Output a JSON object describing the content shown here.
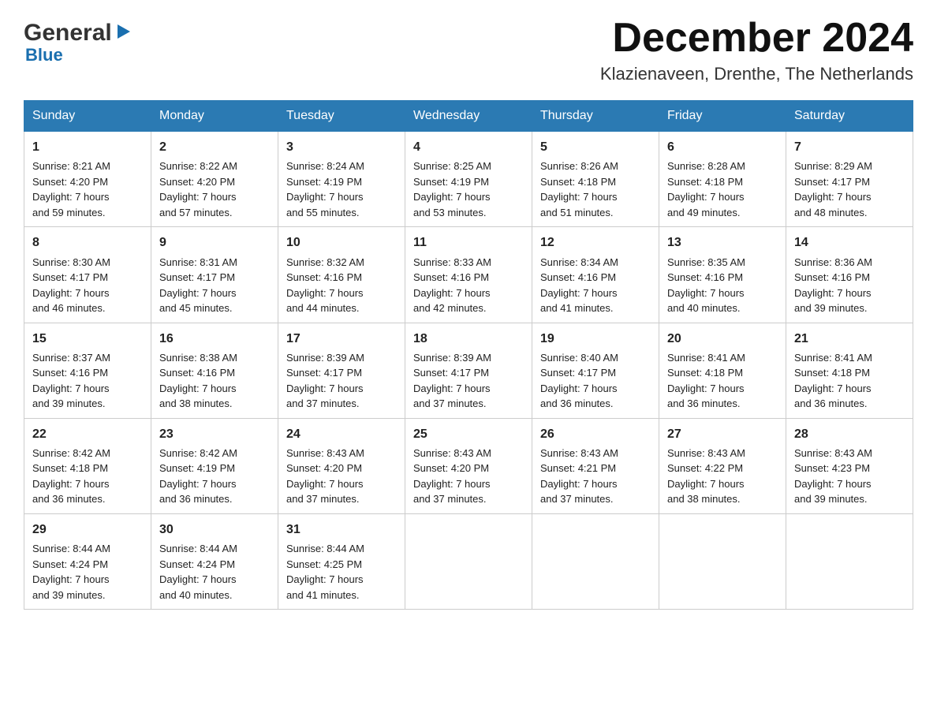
{
  "header": {
    "month_title": "December 2024",
    "location": "Klazienaveen, Drenthe, The Netherlands",
    "logo_general": "General",
    "logo_blue": "Blue"
  },
  "days_of_week": [
    "Sunday",
    "Monday",
    "Tuesday",
    "Wednesday",
    "Thursday",
    "Friday",
    "Saturday"
  ],
  "weeks": [
    [
      {
        "day": "1",
        "sunrise": "8:21 AM",
        "sunset": "4:20 PM",
        "daylight": "7 hours and 59 minutes."
      },
      {
        "day": "2",
        "sunrise": "8:22 AM",
        "sunset": "4:20 PM",
        "daylight": "7 hours and 57 minutes."
      },
      {
        "day": "3",
        "sunrise": "8:24 AM",
        "sunset": "4:19 PM",
        "daylight": "7 hours and 55 minutes."
      },
      {
        "day": "4",
        "sunrise": "8:25 AM",
        "sunset": "4:19 PM",
        "daylight": "7 hours and 53 minutes."
      },
      {
        "day": "5",
        "sunrise": "8:26 AM",
        "sunset": "4:18 PM",
        "daylight": "7 hours and 51 minutes."
      },
      {
        "day": "6",
        "sunrise": "8:28 AM",
        "sunset": "4:18 PM",
        "daylight": "7 hours and 49 minutes."
      },
      {
        "day": "7",
        "sunrise": "8:29 AM",
        "sunset": "4:17 PM",
        "daylight": "7 hours and 48 minutes."
      }
    ],
    [
      {
        "day": "8",
        "sunrise": "8:30 AM",
        "sunset": "4:17 PM",
        "daylight": "7 hours and 46 minutes."
      },
      {
        "day": "9",
        "sunrise": "8:31 AM",
        "sunset": "4:17 PM",
        "daylight": "7 hours and 45 minutes."
      },
      {
        "day": "10",
        "sunrise": "8:32 AM",
        "sunset": "4:16 PM",
        "daylight": "7 hours and 44 minutes."
      },
      {
        "day": "11",
        "sunrise": "8:33 AM",
        "sunset": "4:16 PM",
        "daylight": "7 hours and 42 minutes."
      },
      {
        "day": "12",
        "sunrise": "8:34 AM",
        "sunset": "4:16 PM",
        "daylight": "7 hours and 41 minutes."
      },
      {
        "day": "13",
        "sunrise": "8:35 AM",
        "sunset": "4:16 PM",
        "daylight": "7 hours and 40 minutes."
      },
      {
        "day": "14",
        "sunrise": "8:36 AM",
        "sunset": "4:16 PM",
        "daylight": "7 hours and 39 minutes."
      }
    ],
    [
      {
        "day": "15",
        "sunrise": "8:37 AM",
        "sunset": "4:16 PM",
        "daylight": "7 hours and 39 minutes."
      },
      {
        "day": "16",
        "sunrise": "8:38 AM",
        "sunset": "4:16 PM",
        "daylight": "7 hours and 38 minutes."
      },
      {
        "day": "17",
        "sunrise": "8:39 AM",
        "sunset": "4:17 PM",
        "daylight": "7 hours and 37 minutes."
      },
      {
        "day": "18",
        "sunrise": "8:39 AM",
        "sunset": "4:17 PM",
        "daylight": "7 hours and 37 minutes."
      },
      {
        "day": "19",
        "sunrise": "8:40 AM",
        "sunset": "4:17 PM",
        "daylight": "7 hours and 36 minutes."
      },
      {
        "day": "20",
        "sunrise": "8:41 AM",
        "sunset": "4:18 PM",
        "daylight": "7 hours and 36 minutes."
      },
      {
        "day": "21",
        "sunrise": "8:41 AM",
        "sunset": "4:18 PM",
        "daylight": "7 hours and 36 minutes."
      }
    ],
    [
      {
        "day": "22",
        "sunrise": "8:42 AM",
        "sunset": "4:18 PM",
        "daylight": "7 hours and 36 minutes."
      },
      {
        "day": "23",
        "sunrise": "8:42 AM",
        "sunset": "4:19 PM",
        "daylight": "7 hours and 36 minutes."
      },
      {
        "day": "24",
        "sunrise": "8:43 AM",
        "sunset": "4:20 PM",
        "daylight": "7 hours and 37 minutes."
      },
      {
        "day": "25",
        "sunrise": "8:43 AM",
        "sunset": "4:20 PM",
        "daylight": "7 hours and 37 minutes."
      },
      {
        "day": "26",
        "sunrise": "8:43 AM",
        "sunset": "4:21 PM",
        "daylight": "7 hours and 37 minutes."
      },
      {
        "day": "27",
        "sunrise": "8:43 AM",
        "sunset": "4:22 PM",
        "daylight": "7 hours and 38 minutes."
      },
      {
        "day": "28",
        "sunrise": "8:43 AM",
        "sunset": "4:23 PM",
        "daylight": "7 hours and 39 minutes."
      }
    ],
    [
      {
        "day": "29",
        "sunrise": "8:44 AM",
        "sunset": "4:24 PM",
        "daylight": "7 hours and 39 minutes."
      },
      {
        "day": "30",
        "sunrise": "8:44 AM",
        "sunset": "4:24 PM",
        "daylight": "7 hours and 40 minutes."
      },
      {
        "day": "31",
        "sunrise": "8:44 AM",
        "sunset": "4:25 PM",
        "daylight": "7 hours and 41 minutes."
      },
      null,
      null,
      null,
      null
    ]
  ],
  "labels": {
    "sunrise": "Sunrise:",
    "sunset": "Sunset:",
    "daylight": "Daylight:"
  }
}
